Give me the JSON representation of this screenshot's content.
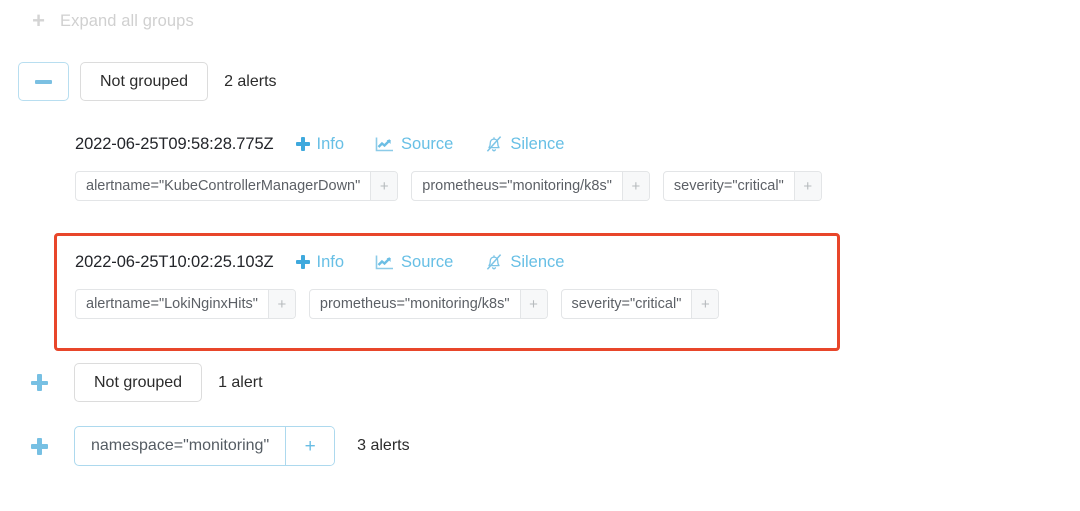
{
  "toolbar": {
    "expand_all_label": "Expand all groups",
    "expand_all_icon": "plus-icon"
  },
  "colors": {
    "accent_blue": "#67bfe5",
    "highlight_red": "#e8462a",
    "chip_border": "#e3e5e7",
    "group_chip_border": "#add9ee",
    "muted_text": "#d0d0d0"
  },
  "groups": [
    {
      "id": "group-1",
      "toggle": "collapse",
      "toggle_icon": "minus-icon",
      "label": "Not grouped",
      "count": "2 alerts",
      "expanded": true
    },
    {
      "id": "group-2",
      "toggle": "expand",
      "toggle_icon": "plus-icon",
      "label": "Not grouped",
      "count": "1 alert",
      "expanded": false
    },
    {
      "id": "group-3",
      "toggle": "expand",
      "toggle_icon": "plus-icon",
      "label": "namespace=\"monitoring\"",
      "chip_plus": "+",
      "count": "3 alerts",
      "expanded": false
    }
  ],
  "alerts": [
    {
      "id": "alert-1",
      "timestamp": "2022-06-25T09:58:28.775Z",
      "actions": [
        {
          "label": "Info",
          "icon": "plus-icon"
        },
        {
          "label": "Source",
          "icon": "chart-line-icon"
        },
        {
          "label": "Silence",
          "icon": "bell-slash-icon"
        }
      ],
      "labels": [
        {
          "text": "alertname=\"KubeControllerManagerDown\"",
          "plus": "+"
        },
        {
          "text": "prometheus=\"monitoring/k8s\"",
          "plus": "+"
        },
        {
          "text": "severity=\"critical\"",
          "plus": "+"
        }
      ],
      "highlighted": false
    },
    {
      "id": "alert-2",
      "timestamp": "2022-06-25T10:02:25.103Z",
      "actions": [
        {
          "label": "Info",
          "icon": "plus-icon"
        },
        {
          "label": "Source",
          "icon": "chart-line-icon"
        },
        {
          "label": "Silence",
          "icon": "bell-slash-icon"
        }
      ],
      "labels": [
        {
          "text": "alertname=\"LokiNginxHits\"",
          "plus": "+"
        },
        {
          "text": "prometheus=\"monitoring/k8s\"",
          "plus": "+"
        },
        {
          "text": "severity=\"critical\"",
          "plus": "+"
        }
      ],
      "highlighted": true
    }
  ]
}
